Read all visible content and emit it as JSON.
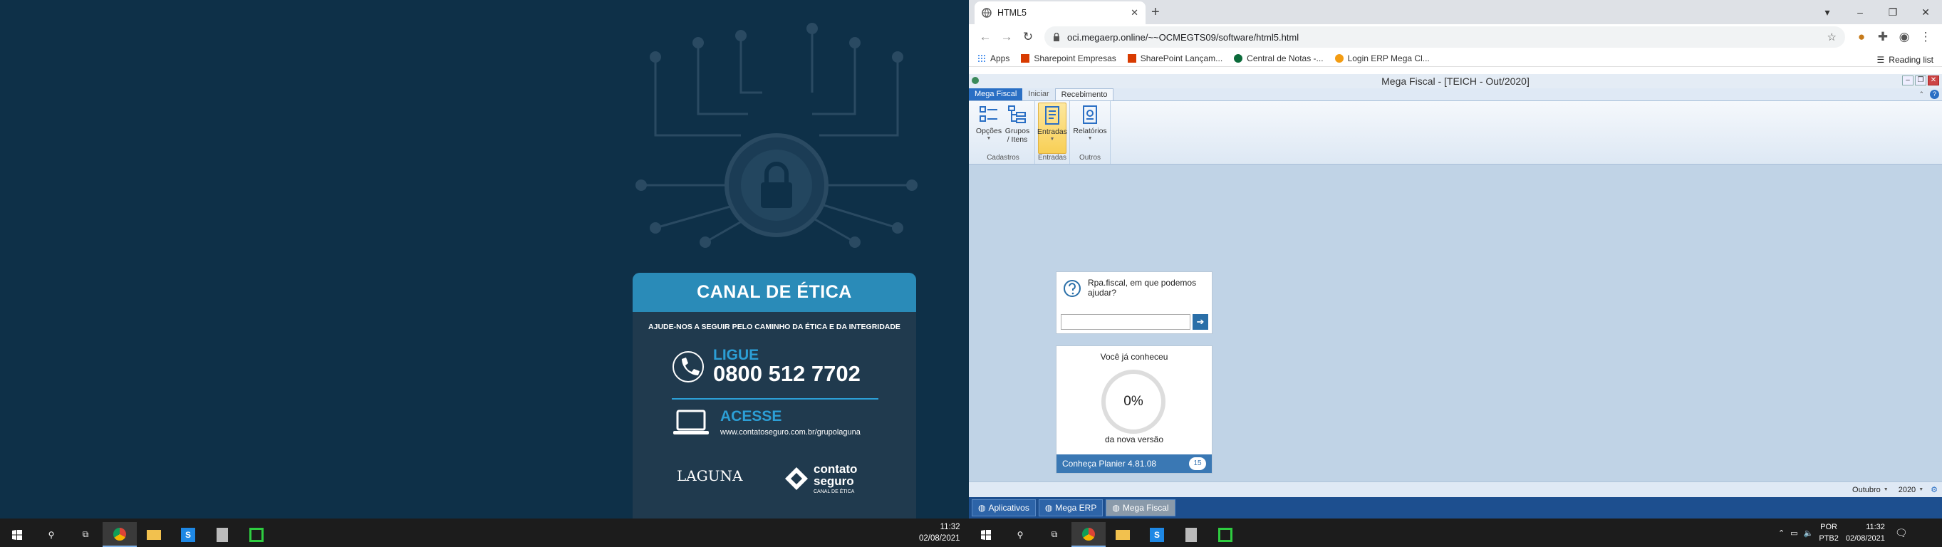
{
  "ethics": {
    "title": "CANAL DE ÉTICA",
    "subtitle": "AJUDE-NOS A SEGUIR PELO CAMINHO DA ÉTICA E DA INTEGRIDADE",
    "call_label": "LIGUE",
    "phone": "0800 512 7702",
    "access_label": "ACESSE",
    "url": "www.contatoseguro.com.br/grupolaguna",
    "logo_left": "LAGUNA",
    "logo_right_line1": "contato",
    "logo_right_line2": "seguro",
    "logo_right_caption": "CANAL DE ÉTICA"
  },
  "browser": {
    "tab_title": "HTML5",
    "url": "oci.megaerp.online/~~OCMEGTS09/software/html5.html",
    "bookmarks": [
      {
        "label": "Apps",
        "color": "#1a73e8"
      },
      {
        "label": "Sharepoint Empresas",
        "color": "#d83b01"
      },
      {
        "label": "SharePoint Lançam...",
        "color": "#d83b01"
      },
      {
        "label": "Central de Notas -...",
        "color": "#0b6a3a"
      },
      {
        "label": "Login ERP Mega Cl...",
        "color": "#f39c12"
      }
    ],
    "reading_list": "Reading list"
  },
  "app": {
    "title": "Mega Fiscal - [TEICH - Out/2020]",
    "tabs": [
      "Mega Fiscal",
      "Iniciar",
      "Recebimento"
    ],
    "groups": [
      {
        "label": "Cadastros",
        "buttons": [
          "Opções",
          "Grupos / Itens"
        ]
      },
      {
        "label": "Entradas",
        "buttons": [
          "Entradas"
        ]
      },
      {
        "label": "Outros",
        "buttons": [
          "Relatórios"
        ]
      }
    ],
    "help_question": "Rpa.fiscal, em que podemos ajudar?",
    "promo_top": "Você já conheceu",
    "promo_percent": "0%",
    "promo_bottom": "da nova versão",
    "promo_link": "Conheça Planier 4.81.08",
    "promo_badge": "15",
    "month": "Outubro",
    "year": "2020",
    "tasks": [
      "Aplicativos",
      "Mega ERP",
      "Mega Fiscal"
    ]
  },
  "taskbar": {
    "left_time": "11:32",
    "left_date": "02/08/2021",
    "right_time": "11:32",
    "right_date": "02/08/2021",
    "lang1": "POR",
    "lang2": "PTB2"
  },
  "colors": {
    "ethics_bg": "#0e3048",
    "ethics_accent": "#2c9fd6",
    "ribbon_tab": "#2a6fc4",
    "app_bg": "#c0d3e6"
  }
}
